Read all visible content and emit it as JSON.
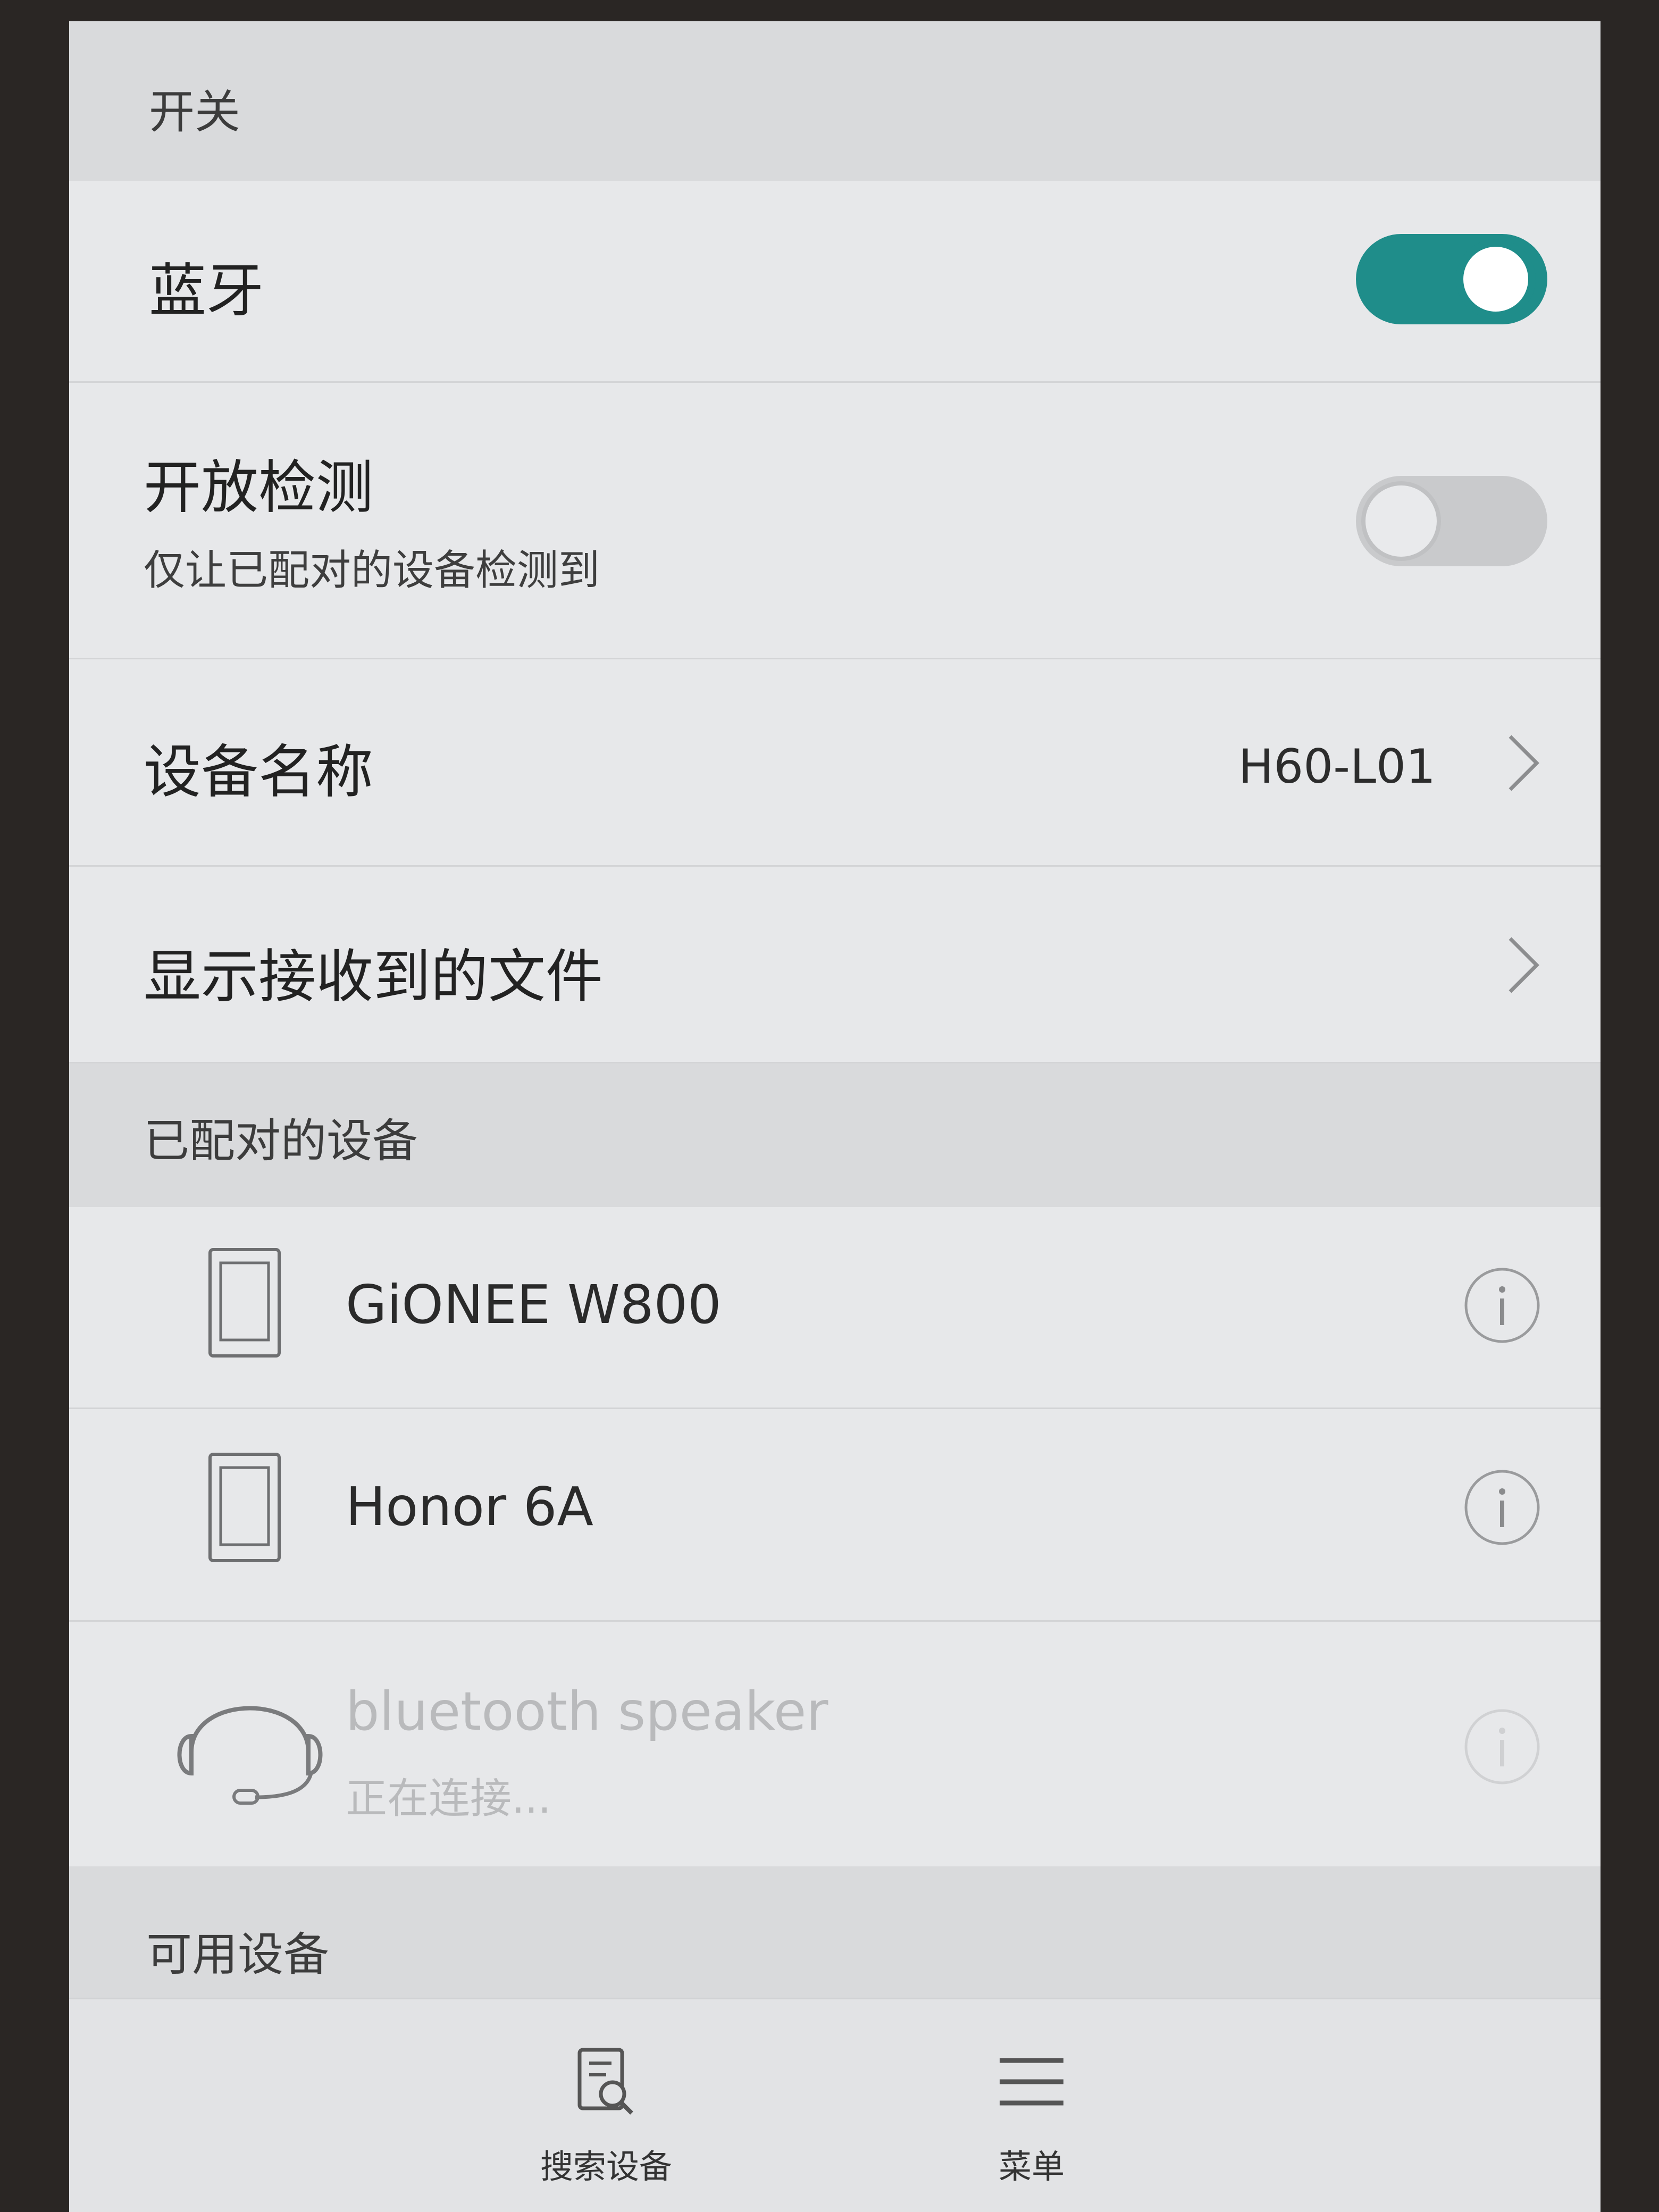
{
  "switch_section": {
    "label": "开关"
  },
  "bluetooth": {
    "label": "蓝牙",
    "enabled": true
  },
  "visibility": {
    "label": "开放检测",
    "description": "仅让已配对的设备检测到",
    "enabled": false
  },
  "device_name": {
    "label": "设备名称",
    "value": "H60-L01"
  },
  "received_files": {
    "label": "显示接收到的文件"
  },
  "paired_section": {
    "label": "已配对的设备"
  },
  "paired_devices": [
    {
      "name": "GiONEE W800",
      "icon": "phone-icon"
    },
    {
      "name": "Honor 6A",
      "icon": "phone-icon"
    },
    {
      "name": "bluetooth speaker",
      "status": "正在连接...",
      "icon": "headset-icon"
    }
  ],
  "available_section": {
    "label": "可用设备"
  },
  "bottom_bar": {
    "search_label": "搜索设备",
    "menu_label": "菜单"
  },
  "colors": {
    "accent": "#1f8d8a",
    "background": "#e6e7e9",
    "section_bg": "#d9dadc"
  }
}
